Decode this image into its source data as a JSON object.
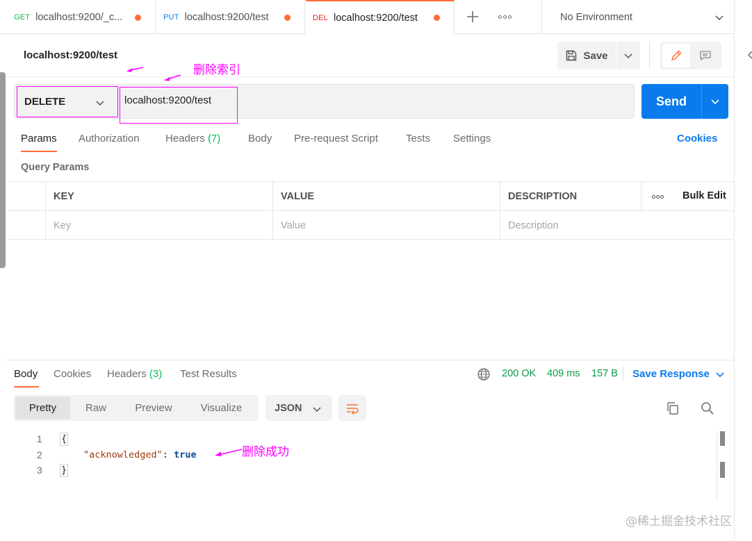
{
  "tabs": [
    {
      "method": "GET",
      "method_color": "#0cbb52",
      "name": "localhost:9200/_c..."
    },
    {
      "method": "PUT",
      "method_color": "#097bed",
      "name": "localhost:9200/test"
    },
    {
      "method": "DEL",
      "method_color": "#eb2013",
      "name": "localhost:9200/test"
    }
  ],
  "environment": {
    "label": "No Environment"
  },
  "request": {
    "title": "localhost:9200/test",
    "save_label": "Save",
    "method": "DELETE",
    "url": "localhost:9200/test",
    "send_label": "Send"
  },
  "annotations": {
    "delete_index": "删除索引",
    "delete_success": "删除成功"
  },
  "request_tabs": {
    "params": "Params",
    "authorization": "Authorization",
    "headers": "Headers",
    "headers_count": "(7)",
    "body": "Body",
    "prerequest": "Pre-request Script",
    "tests": "Tests",
    "settings": "Settings",
    "cookies": "Cookies"
  },
  "query_params": {
    "title": "Query Params",
    "columns": {
      "key": "KEY",
      "value": "VALUE",
      "description": "DESCRIPTION"
    },
    "placeholders": {
      "key": "Key",
      "value": "Value",
      "description": "Description"
    },
    "bulk_edit": "Bulk Edit"
  },
  "response": {
    "tabs": {
      "body": "Body",
      "cookies": "Cookies",
      "headers": "Headers",
      "headers_count": "(3)",
      "test_results": "Test Results"
    },
    "status": "200 OK",
    "time": "409 ms",
    "size": "157 B",
    "save_response": "Save Response",
    "formats": [
      "Pretty",
      "Raw",
      "Preview",
      "Visualize"
    ],
    "language": "JSON",
    "lines": {
      "n1": "1",
      "n2": "2",
      "n3": "3",
      "open": "{",
      "key": "\"acknowledged\"",
      "colon": ": ",
      "value": "true",
      "close": "}"
    }
  },
  "watermark": "@稀土掘金技术社区",
  "colors": {
    "accent": "#ff6c37",
    "primary": "#097bed",
    "annotation": "#ff00ff",
    "success": "#0a9a46"
  }
}
